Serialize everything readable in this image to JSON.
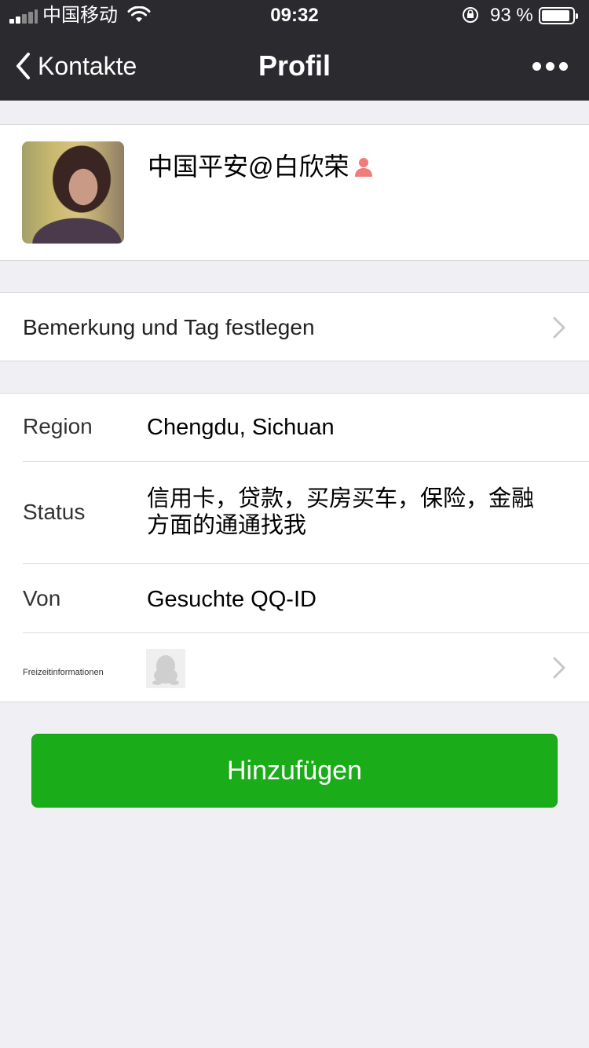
{
  "status_bar": {
    "carrier": "中国移动",
    "time": "09:32",
    "battery_percent": "93 %",
    "battery_level": 0.93
  },
  "nav": {
    "back_label": "Kontakte",
    "title": "Profil"
  },
  "profile": {
    "name": "中国平安@白欣荣"
  },
  "remark": {
    "label": "Bemerkung und Tag festlegen"
  },
  "info": {
    "region_label": "Region",
    "region_value": "Chengdu, Sichuan",
    "status_label": "Status",
    "status_value_line1": "信用卡，贷款，买房买车，保险，金融",
    "status_value_line2": "方面的通通找我",
    "source_label": "Von",
    "source_value": "Gesuchte QQ-ID",
    "leisure_label": "Freizeitinformationen"
  },
  "actions": {
    "add_label": "Hinzufügen"
  },
  "colors": {
    "accent_green": "#1aad19",
    "nav_background": "#2b2b2f",
    "page_background": "#efeff4",
    "person_icon": "#f07c7c"
  }
}
